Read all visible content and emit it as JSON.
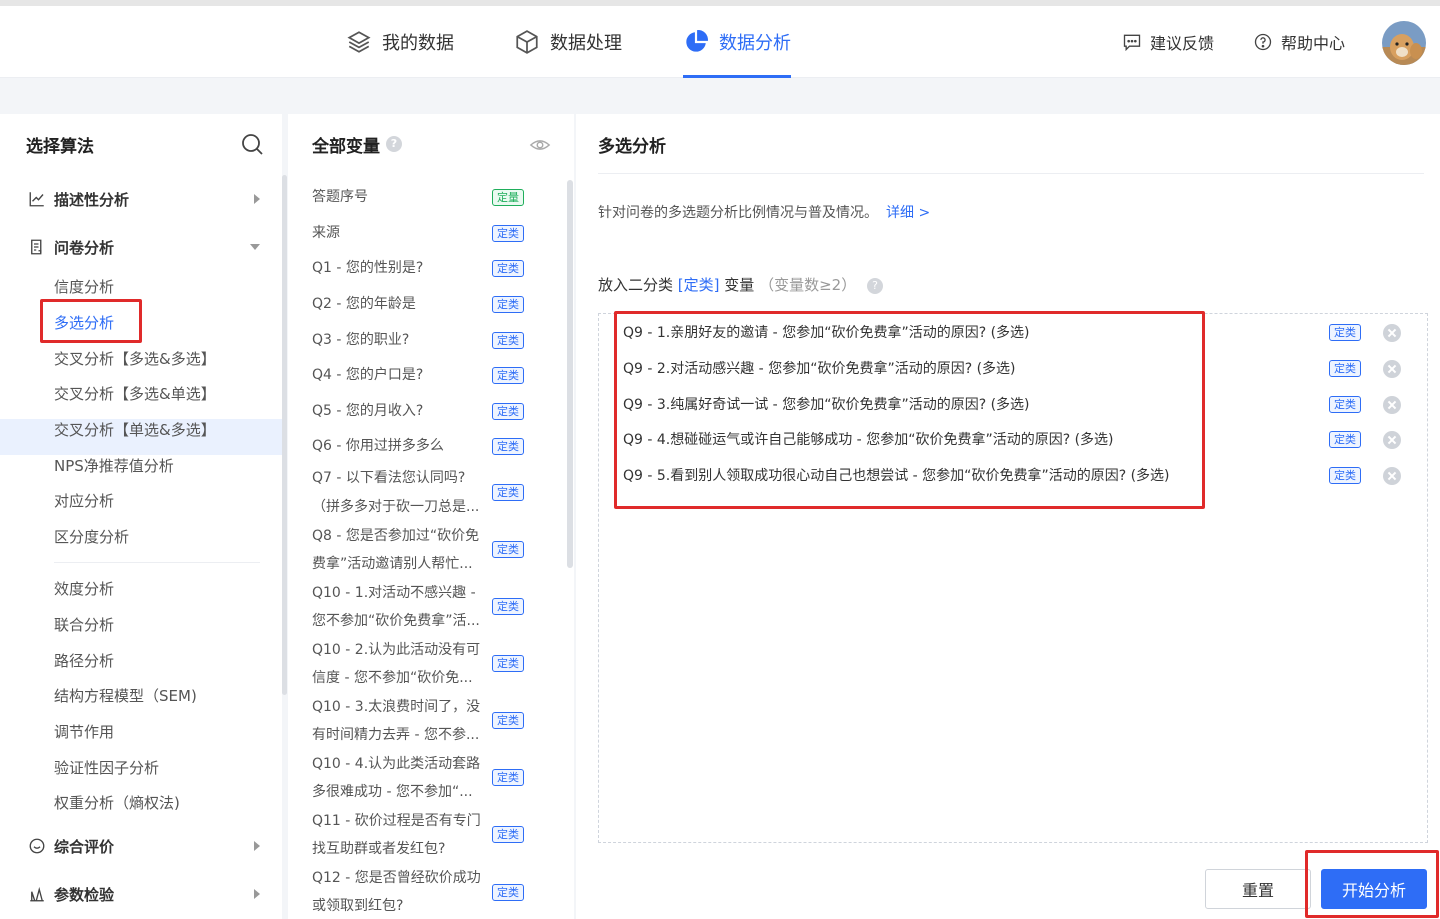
{
  "header": {
    "nav": [
      {
        "label": "我的数据"
      },
      {
        "label": "数据处理"
      },
      {
        "label": "数据分析"
      }
    ],
    "feedback": "建议反馈",
    "help": "帮助中心"
  },
  "left": {
    "title": "选择算法",
    "groups": [
      "描述性分析",
      "问卷分析",
      "综合评价",
      "参数检验"
    ],
    "items": [
      "信度分析",
      "多选分析",
      "交叉分析【多选&多选】",
      "交叉分析【多选&单选】",
      "交叉分析【单选&多选】",
      "NPS净推荐值分析",
      "对应分析",
      "区分度分析",
      "效度分析",
      "联合分析",
      "路径分析",
      "结构方程模型（SEM)",
      "调节作用",
      "验证性因子分析",
      "权重分析（熵权法)"
    ]
  },
  "middle": {
    "title": "全部变量",
    "help": "?",
    "vars": [
      {
        "text": "答题序号",
        "tag": "定量"
      },
      {
        "text": "来源",
        "tag": "定类"
      },
      {
        "text": "Q1 - 您的性别是?",
        "tag": "定类"
      },
      {
        "text": "Q2 - 您的年龄是",
        "tag": "定类"
      },
      {
        "text": "Q3 - 您的职业?",
        "tag": "定类"
      },
      {
        "text": "Q4 - 您的户口是?",
        "tag": "定类"
      },
      {
        "text": "Q5 - 您的月收入?",
        "tag": "定类"
      },
      {
        "text": "Q6 - 你用过拼多多么",
        "tag": "定类"
      },
      {
        "l1": "Q7 - 以下看法您认同吗?",
        "l2": "（拼多多对于砍一刀总是...",
        "tag": "定类"
      },
      {
        "l1": "Q8 - 您是否参加过“砍价免",
        "l2": "费拿”活动邀请别人帮忙...",
        "tag": "定类"
      },
      {
        "l1": "Q10 - 1.对活动不感兴趣 -",
        "l2": "您不参加“砍价免费拿”活...",
        "tag": "定类"
      },
      {
        "l1": "Q10 - 2.认为此活动没有可",
        "l2": "信度 - 您不参加“砍价免...",
        "tag": "定类"
      },
      {
        "l1": "Q10 - 3.太浪费时间了，没",
        "l2": "有时间精力去弄 - 您不参...",
        "tag": "定类"
      },
      {
        "l1": "Q10 - 4.认为此类活动套路",
        "l2": "多很难成功 - 您不参加“...",
        "tag": "定类"
      },
      {
        "l1": "Q11 - 砍价过程是否有专门",
        "l2": "找互助群或者发红包?",
        "tag": "定类"
      },
      {
        "l1": "Q12 - 您是否曾经砍价成功",
        "l2": "或领取到红包?",
        "tag": "定类"
      }
    ]
  },
  "right": {
    "title": "多选分析",
    "desc": "针对问卷的多选题分析比例情况与普及情况。",
    "more": "详细 >",
    "put_label_pre": "放入二分类",
    "put_label_hl": "[定类]",
    "put_label_post": "变量",
    "put_label_gray": "（变量数≥2）",
    "help": "?",
    "selected": [
      {
        "text": "Q9 - 1.亲朋好友的邀请 - 您参加“砍价免费拿”活动的原因?  (多选)",
        "tag": "定类"
      },
      {
        "text": "Q9 - 2.对活动感兴趣 - 您参加“砍价免费拿”活动的原因?  (多选)",
        "tag": "定类"
      },
      {
        "text": "Q9 - 3.纯属好奇试一试 - 您参加“砍价免费拿”活动的原因?  (多选)",
        "tag": "定类"
      },
      {
        "text": "Q9 - 4.想碰碰运气或许自己能够成功 - 您参加“砍价免费拿”活动的原因?  (多选)",
        "tag": "定类"
      },
      {
        "text": "Q9 - 5.看到别人领取成功很心动自己也想尝试 - 您参加“砍价免费拿”活动的原因?  (多选)",
        "tag": "定类"
      }
    ],
    "reset": "重置",
    "start": "开始分析"
  },
  "colors": {
    "accent": "#2e6df6",
    "highlight": "#e02a2a"
  }
}
